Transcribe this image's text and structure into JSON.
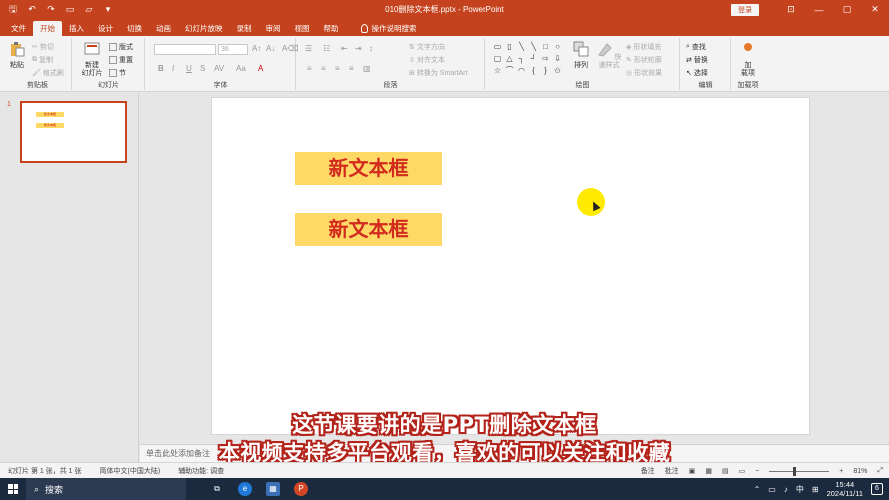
{
  "titlebar": {
    "doc_title": "010删除文本框.pptx",
    "app_name": "PowerPoint",
    "separator": "  -  ",
    "login_label": "登录",
    "minimize": "—",
    "maximize": "▢",
    "close": "✕"
  },
  "tabs": [
    {
      "label": "文件"
    },
    {
      "label": "开始"
    },
    {
      "label": "插入"
    },
    {
      "label": "设计"
    },
    {
      "label": "切换"
    },
    {
      "label": "动画"
    },
    {
      "label": "幻灯片放映"
    },
    {
      "label": "录制"
    },
    {
      "label": "审阅"
    },
    {
      "label": "视图"
    },
    {
      "label": "帮助"
    }
  ],
  "tellme": "操作说明搜索",
  "ribbon": {
    "clipboard": {
      "label": "剪贴板",
      "paste": "粘贴",
      "cut": "剪切",
      "copy": "复制",
      "format_painter": "格式刷"
    },
    "slides": {
      "label": "幻灯片",
      "new_slide_1": "新建",
      "new_slide_2": "幻灯片",
      "layout": "版式",
      "reset": "重置",
      "section": "节"
    },
    "font": {
      "label": "字体",
      "bold": "B",
      "italic": "I",
      "underline": "U",
      "strike": "S",
      "size": "36"
    },
    "paragraph": {
      "label": "段落",
      "text_direction": "文字方向",
      "align_text": "对齐文本",
      "smartart": "转换为 SmartArt"
    },
    "drawing": {
      "label": "绘图",
      "arrange": "排列",
      "quick_styles": "快速样式",
      "shape_fill": "形状填充",
      "shape_outline": "形状轮廓",
      "shape_effects": "形状效果"
    },
    "editing": {
      "label": "编辑",
      "find": "查找",
      "replace": "替换",
      "select": "选择"
    },
    "addins": {
      "label": "加载项",
      "btn_1": "加",
      "btn_2": "载项"
    }
  },
  "thumbnail": {
    "number": "1",
    "box1": "新文本框",
    "box2": "新文本框"
  },
  "slide": {
    "textbox1": "新文本框",
    "textbox2": "新文本框"
  },
  "notes_placeholder": "单击此处添加备注",
  "subtitles": {
    "line1": "这节课要讲的是PPT删除文本框",
    "line2": "本视频支持多平台观看，喜欢的可以关注和收藏"
  },
  "statusbar": {
    "slide_info": "幻灯片 第 1 张，共 1 张",
    "language": "简体中文(中国大陆)",
    "accessibility": "辅助功能: 调查",
    "notes": "备注",
    "comments": "批注",
    "zoom": "81%"
  },
  "taskbar": {
    "search": "搜索",
    "ime": "中",
    "time": "15:44",
    "date": "2024/11/11",
    "notifications": "6"
  },
  "colors": {
    "accent": "#c4431e",
    "textbox_fill": "#ffd966",
    "textbox_text": "#d22a1e",
    "subtitle_stroke": "#b3231a"
  }
}
